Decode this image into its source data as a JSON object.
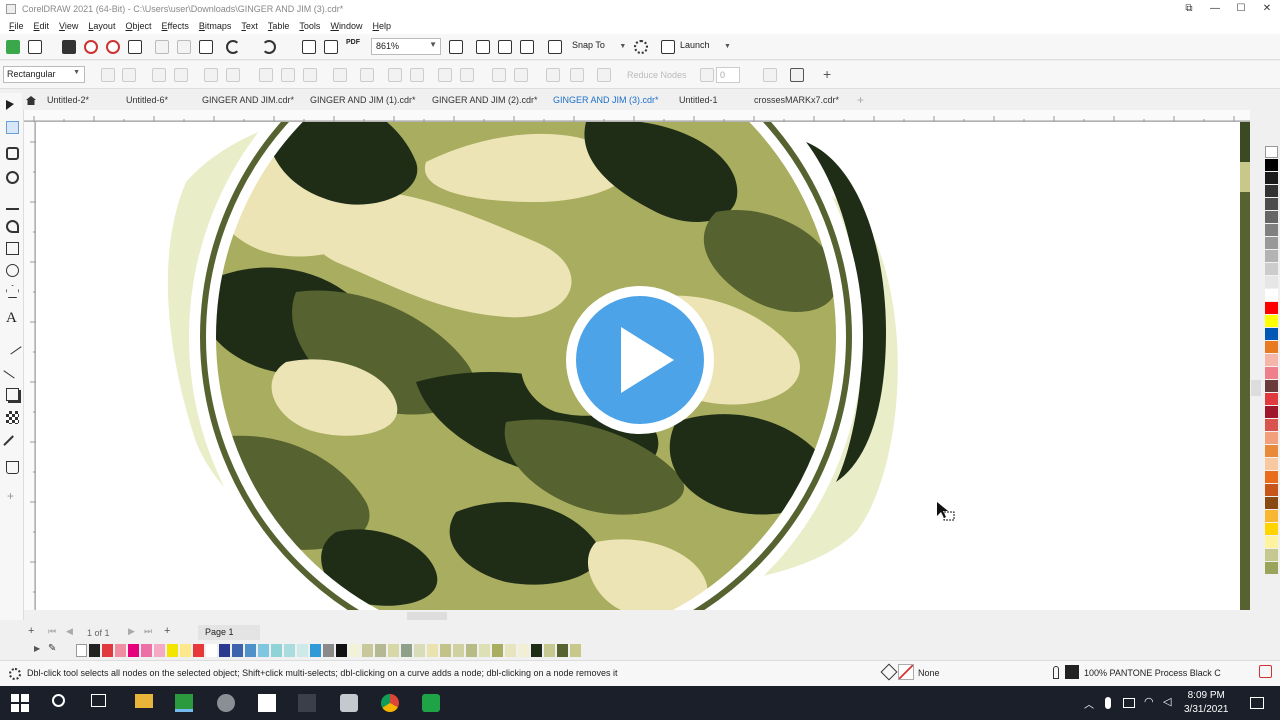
{
  "window": {
    "title": "CorelDRAW 2021 (64-Bit) - C:\\Users\\user\\Downloads\\GINGER AND JIM (3).cdr*",
    "controls": [
      "⧉",
      "—",
      "☐",
      "✕"
    ]
  },
  "menu": [
    "File",
    "Edit",
    "View",
    "Layout",
    "Object",
    "Effects",
    "Bitmaps",
    "Text",
    "Table",
    "Tools",
    "Window",
    "Help"
  ],
  "standard_toolbar": {
    "zoom_value": "861%",
    "snap_to_label": "Snap To",
    "launch_label": "Launch",
    "pdf_label": "PDF"
  },
  "property_bar": {
    "shape_select": "Rectangular",
    "smooth_label": "Reduce Nodes",
    "smooth_value": "0"
  },
  "tabs": [
    {
      "label": "Untitled-2*",
      "active": false
    },
    {
      "label": "Untitled-6*",
      "active": false
    },
    {
      "label": "GINGER AND JIM.cdr*",
      "active": false
    },
    {
      "label": "GINGER AND JIM (1).cdr*",
      "active": false
    },
    {
      "label": "GINGER AND JIM (2).cdr*",
      "active": false
    },
    {
      "label": "GINGER AND JIM (3).cdr*",
      "active": true
    },
    {
      "label": "Untitled-1",
      "active": false
    },
    {
      "label": "crossesMARKx7.cdr*",
      "active": false
    }
  ],
  "page_nav": {
    "count": "1 of 1",
    "page_tab": "Page 1"
  },
  "status": {
    "hint": "Dbl-click tool selects all nodes on the selected object; Shift+click multi-selects; dbl-clicking on a curve adds a node; dbl-clicking on a node removes it",
    "fill": "None",
    "outline": "100% PANTONE Process Black C"
  },
  "taskbar": {
    "time": "8:09 PM",
    "date": "3/31/2021"
  },
  "colors": {
    "accent": "#1d6fc9",
    "play_button": "#4da3e8",
    "camo_dark": "#1f2d17",
    "camo_mid": "#56622f",
    "camo_light": "#a9ad5f",
    "camo_pale": "#ece4b4"
  }
}
